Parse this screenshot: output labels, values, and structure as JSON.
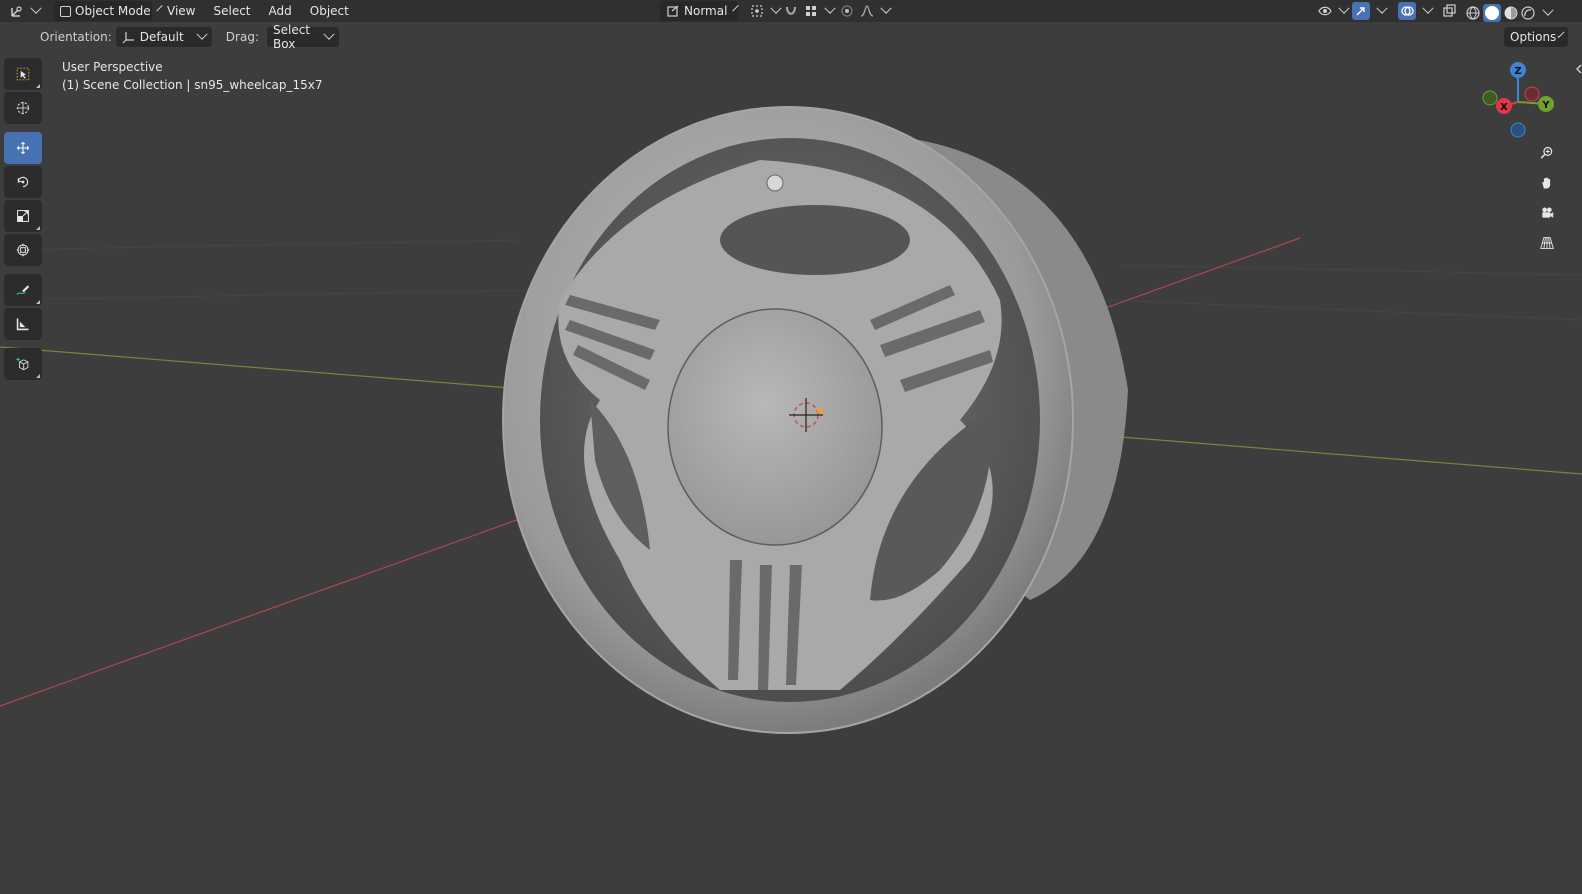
{
  "header": {
    "mode_label": "Object Mode",
    "menus": [
      "View",
      "Select",
      "Add",
      "Object"
    ],
    "transform_orientation": "Normal"
  },
  "tool_settings": {
    "orientation_label": "Orientation:",
    "orientation_value": "Default",
    "drag_label": "Drag:",
    "drag_value": "Select Box",
    "options_label": "Options"
  },
  "viewport": {
    "perspective": "User Perspective",
    "collection_info": "(1) Scene Collection | sn95_wheelcap_15x7"
  },
  "gizmo": {
    "z": "Z",
    "x": "X",
    "y": "Y"
  },
  "colors": {
    "active_tool": "#4772b3",
    "axis_x": "#c8454f",
    "axis_y": "#6fa32e",
    "axis_z": "#3f83d6"
  }
}
